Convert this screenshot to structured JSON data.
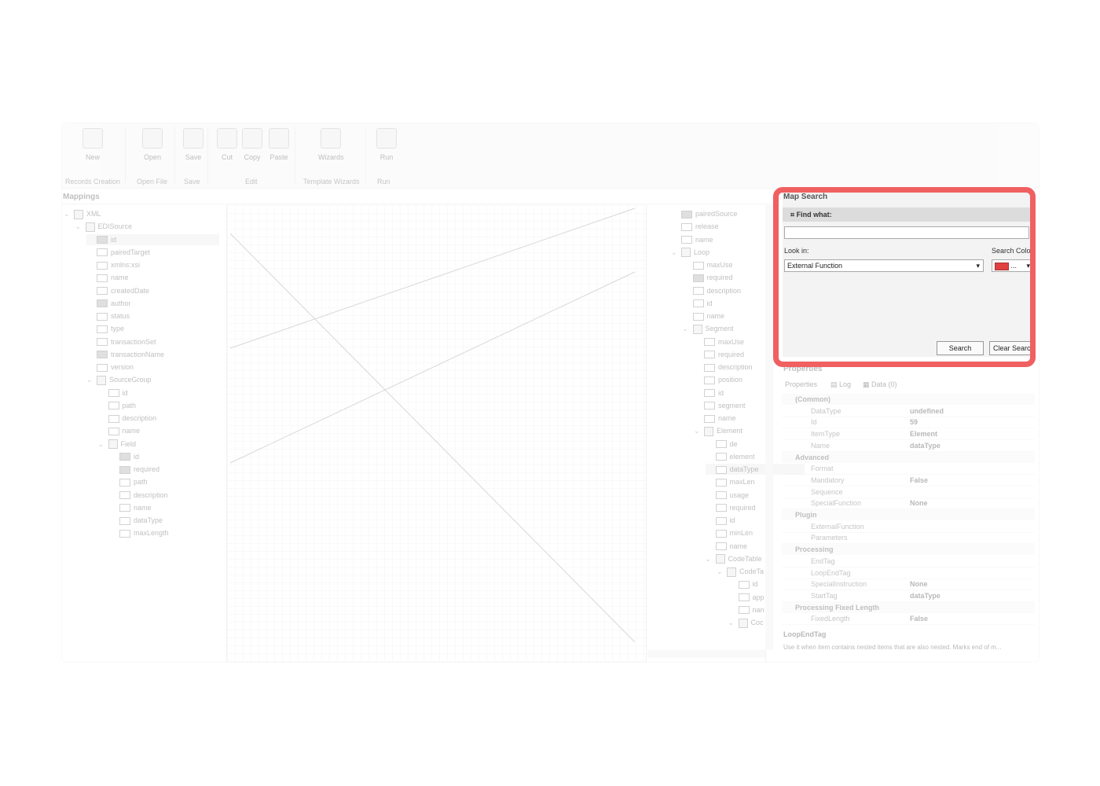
{
  "ribbon": {
    "buttons": [
      "New",
      "Open",
      "Save",
      "Cut",
      "Copy",
      "Paste",
      "Wizards",
      "Run"
    ],
    "groups": [
      "Records Creation",
      "Open File",
      "Save",
      "Edit",
      "Template Wizards",
      "Run"
    ]
  },
  "mappings": {
    "title": "Mappings",
    "left_tree": [
      "XML",
      "EDISource",
      "id",
      "pairedTarget",
      "xmlns:xsi",
      "name",
      "createdDate",
      "author",
      "status",
      "type",
      "transactionSet",
      "transactionName",
      "version",
      "SourceGroup",
      "id",
      "path",
      "description",
      "name",
      "Field",
      "id",
      "required",
      "path",
      "description",
      "name",
      "dataType",
      "maxLength"
    ],
    "right_tree": [
      "pairedSource",
      "release",
      "name",
      "Loop",
      "maxUse",
      "required",
      "description",
      "id",
      "name",
      "Segment",
      "maxUse",
      "required",
      "description",
      "position",
      "id",
      "segment",
      "name",
      "Element",
      "de",
      "element",
      "dataType",
      "maxLen",
      "usage",
      "required",
      "id",
      "minLen",
      "name",
      "CodeTable",
      "CodeTa",
      "id",
      "app",
      "nan",
      "Coc"
    ]
  },
  "map_search": {
    "title": "Map Search",
    "find_what_label": "Find what:",
    "find_value": "",
    "look_in_label": "Look in:",
    "look_in_value": "External Function",
    "search_color_label": "Search Color",
    "search_color_swatch": "#e04040",
    "search_color_text": "...",
    "search_button": "Search",
    "clear_button": "Clear Search"
  },
  "properties": {
    "title": "Properties",
    "tabs": [
      "Properties",
      "Log",
      "Data (0)"
    ],
    "categories": [
      {
        "name": "(Common)",
        "rows": [
          [
            "DataType",
            "undefined"
          ],
          [
            "Id",
            "59"
          ],
          [
            "ItemType",
            "Element"
          ],
          [
            "Name",
            "dataType"
          ]
        ]
      },
      {
        "name": "Advanced",
        "rows": [
          [
            "Format",
            ""
          ],
          [
            "Mandatory",
            "False"
          ],
          [
            "Sequence",
            ""
          ],
          [
            "SpecialFunction",
            "None"
          ]
        ]
      },
      {
        "name": "Plugin",
        "rows": [
          [
            "ExternalFunction",
            ""
          ],
          [
            "Parameters",
            ""
          ]
        ]
      },
      {
        "name": "Processing",
        "rows": [
          [
            "EndTag",
            ""
          ],
          [
            "LoopEndTag",
            ""
          ],
          [
            "SpecialInstruction",
            "None"
          ],
          [
            "StartTag",
            "dataType"
          ]
        ]
      },
      {
        "name": "Processing Fixed Length",
        "rows": [
          [
            "FixedLength",
            "False"
          ]
        ]
      }
    ],
    "desc_title": "LoopEndTag",
    "desc_text": "Use it when item contains nested items that are also nested. Marks end of m..."
  }
}
